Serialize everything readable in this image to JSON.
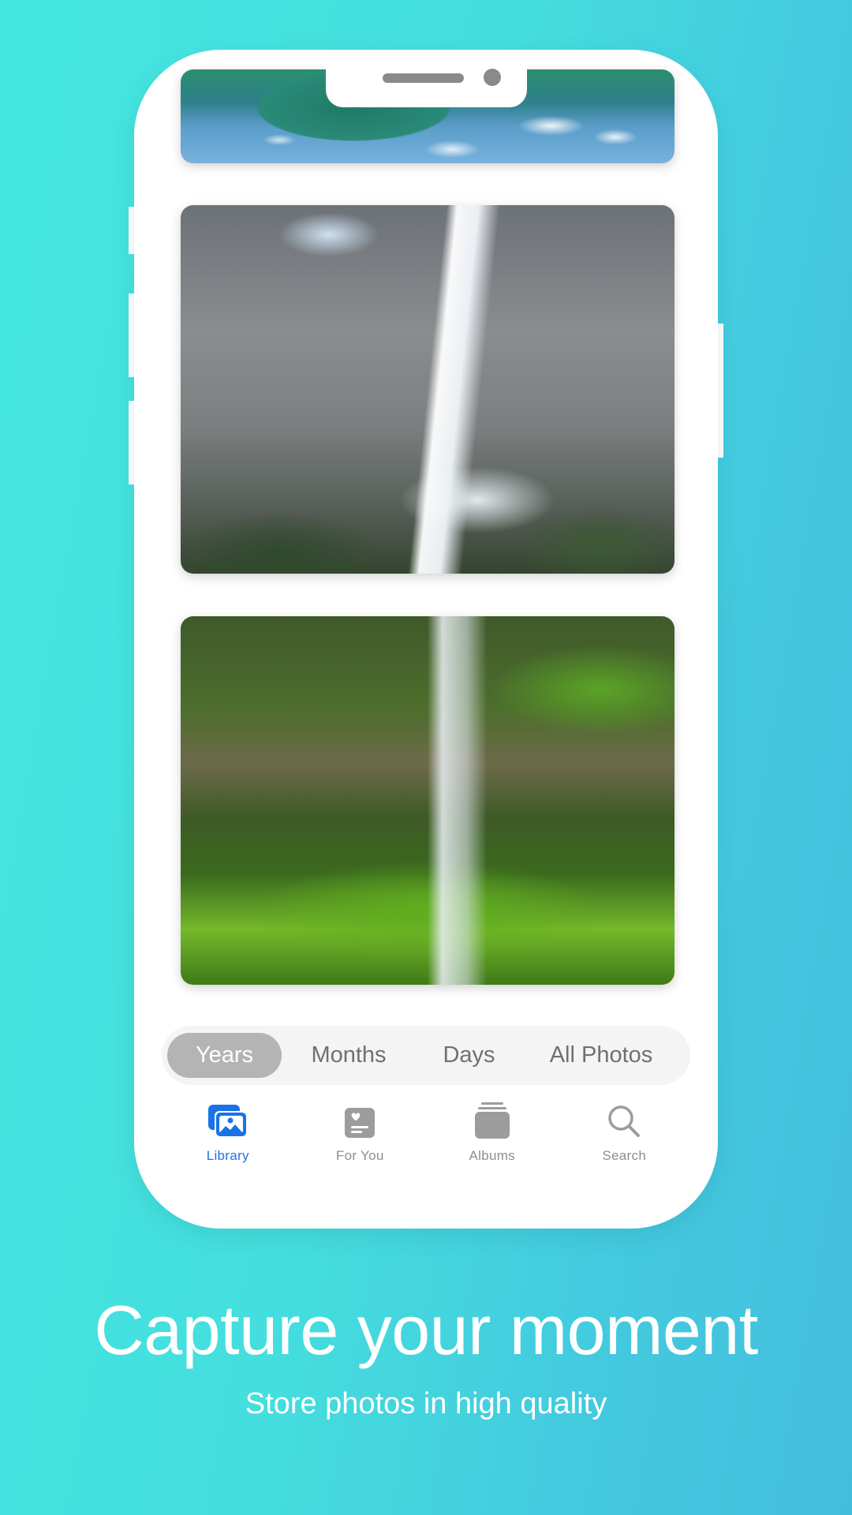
{
  "colors": {
    "background_start": "#45e6e1",
    "background_end": "#44bddc",
    "phone_body": "#ffffff",
    "accent_blue": "#1a73e6",
    "inactive_gray": "#8e8e8e",
    "segment_active_bg": "#b4b4b4"
  },
  "photos": [
    {
      "name": "lake-reflection-photo",
      "description": "Lake reflecting mountains and clouds"
    },
    {
      "name": "yosemite-waterfall-photo",
      "description": "Tall waterfall between granite cliffs"
    },
    {
      "name": "mossy-waterfall-photo",
      "description": "Small waterfall over moss-covered rocks"
    }
  ],
  "segmented_control": {
    "options": [
      {
        "label": "Years",
        "selected": true
      },
      {
        "label": "Months",
        "selected": false
      },
      {
        "label": "Days",
        "selected": false
      },
      {
        "label": "All Photos",
        "selected": false
      }
    ]
  },
  "tab_bar": {
    "items": [
      {
        "label": "Library",
        "icon": "photo-library-icon",
        "active": true
      },
      {
        "label": "For You",
        "icon": "for-you-icon",
        "active": false
      },
      {
        "label": "Albums",
        "icon": "albums-stack-icon",
        "active": false
      },
      {
        "label": "Search",
        "icon": "search-icon",
        "active": false
      }
    ]
  },
  "promo": {
    "headline": "Capture your moment",
    "subheadline": "Store photos in high quality"
  }
}
